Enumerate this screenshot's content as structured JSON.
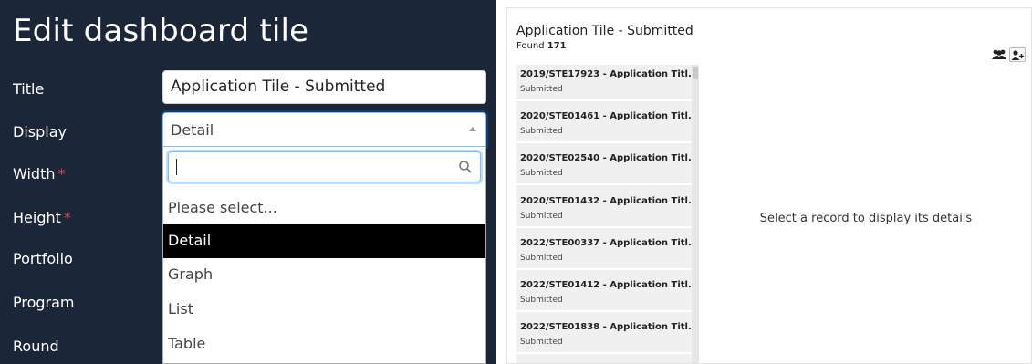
{
  "edit_panel": {
    "title": "Edit dashboard tile",
    "labels": {
      "title": "Title",
      "display": "Display",
      "width": "Width",
      "height": "Height",
      "portfolio": "Portfolio",
      "program": "Program",
      "round": "Round"
    },
    "required_marker": "*",
    "title_value": "Application Tile - Submitted",
    "display_value": "Detail",
    "search_value": "",
    "options": [
      "Please select...",
      "Detail",
      "Graph",
      "List",
      "Table"
    ],
    "selected_option": "Detail"
  },
  "tile": {
    "title": "Application Tile - Submitted",
    "found_label": "Found",
    "found_count": "171",
    "records": [
      {
        "title": "2019/STE17923 - Application Titl...",
        "status": "Submitted"
      },
      {
        "title": "2020/STE01461 - Application Titl...",
        "status": "Submitted"
      },
      {
        "title": "2020/STE02540 - Application Titl...",
        "status": "Submitted"
      },
      {
        "title": "2020/STE01432 - Application Titl...",
        "status": "Submitted"
      },
      {
        "title": "2022/STE00337 - Application Titl...",
        "status": "Submitted"
      },
      {
        "title": "2022/STE01412 - Application Titl...",
        "status": "Submitted"
      },
      {
        "title": "2022/STE01838 - Application Titl...",
        "status": "Submitted"
      }
    ],
    "placeholder": "Select a record to display its details",
    "icons": [
      "group-icon",
      "add-user-icon"
    ]
  },
  "colors": {
    "panel_bg": "#1b2639",
    "required": "#e0455a",
    "selected_option_bg": "#000000",
    "focus_border": "#80bdff"
  }
}
